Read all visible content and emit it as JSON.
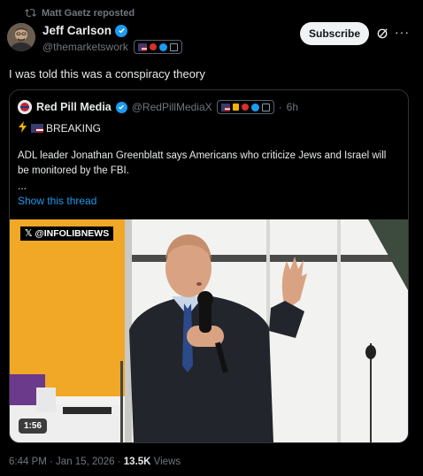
{
  "repost": {
    "text": "Matt Gaetz reposted"
  },
  "author": {
    "name": "Jeff Carlson",
    "handle": "@themarketswork"
  },
  "actions": {
    "subscribe_label": "Subscribe",
    "more_label": "···"
  },
  "tweet": {
    "text": "I was told this was a conspiracy theory"
  },
  "quote": {
    "name": "Red Pill Media",
    "handle": "@RedPillMediaX",
    "dot": "·",
    "time": "6h",
    "breaking": "BREAKING",
    "body": "ADL leader Jonathan Greenblatt says Americans who criticize Jews and Israel will be monitored by the FBI.",
    "ellipsis": "...",
    "show_thread": "Show this thread"
  },
  "media": {
    "watermark": "@INFOLIBNEWS",
    "watermark_x": "𝕏",
    "duration": "1:56"
  },
  "footer": {
    "time": "6:44 PM · Jan 15, 2026 · ",
    "views_count": "13.5K",
    "views_label": " Views"
  },
  "colors": {
    "accent": "#1d9bf0",
    "background": "#000000",
    "muted": "#71767b"
  }
}
